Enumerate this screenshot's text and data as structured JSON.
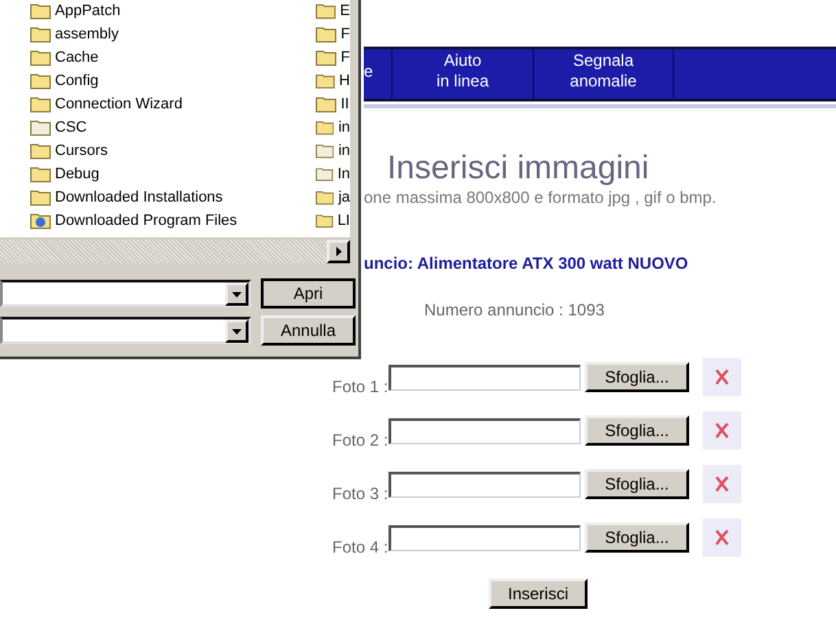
{
  "file_dialog": {
    "files": [
      {
        "name": "AppPatch",
        "kind": "folder"
      },
      {
        "name": "assembly",
        "kind": "folder"
      },
      {
        "name": "Cache",
        "kind": "folder"
      },
      {
        "name": "Config",
        "kind": "folder"
      },
      {
        "name": "Connection Wizard",
        "kind": "folder"
      },
      {
        "name": "CSC",
        "kind": "hidden-folder"
      },
      {
        "name": "Cursors",
        "kind": "folder"
      },
      {
        "name": "Debug",
        "kind": "folder"
      },
      {
        "name": "Downloaded Installations",
        "kind": "folder"
      },
      {
        "name": "Downloaded Program Files",
        "kind": "web-folder"
      }
    ],
    "files_column_2": [
      {
        "name": "E",
        "kind": "folder"
      },
      {
        "name": "F",
        "kind": "folder"
      },
      {
        "name": "F",
        "kind": "folder"
      },
      {
        "name": "H",
        "kind": "folder"
      },
      {
        "name": "II",
        "kind": "folder"
      },
      {
        "name": "in",
        "kind": "folder"
      },
      {
        "name": "in",
        "kind": "hidden-folder"
      },
      {
        "name": "In",
        "kind": "hidden-folder"
      },
      {
        "name": "ja",
        "kind": "folder"
      },
      {
        "name": "LI",
        "kind": "folder"
      }
    ],
    "buttons": [
      "Apri",
      "Annulla"
    ]
  },
  "nav": {
    "items": [
      {
        "lines": [
          "e"
        ]
      },
      {
        "lines": [
          "Aiuto",
          "in linea"
        ]
      },
      {
        "lines": [
          "Segnala",
          "anomalie"
        ]
      }
    ]
  },
  "heading": "Inserisci immagini",
  "subtitle": "one massima 800x800 e formato jpg , gif o bmp.",
  "ad_title": "uncio: Alimentatore ATX 300 watt NUOVO",
  "ad_number": "Numero annuncio : 1093",
  "photo_rows": [
    {
      "label": "Foto 1 :",
      "button": "Sfoglia..."
    },
    {
      "label": "Foto 2 :",
      "button": "Sfoglia..."
    },
    {
      "label": "Foto 3 :",
      "button": "Sfoglia..."
    },
    {
      "label": "Foto 4 :",
      "button": "Sfoglia..."
    }
  ],
  "submit": "Inserisci"
}
